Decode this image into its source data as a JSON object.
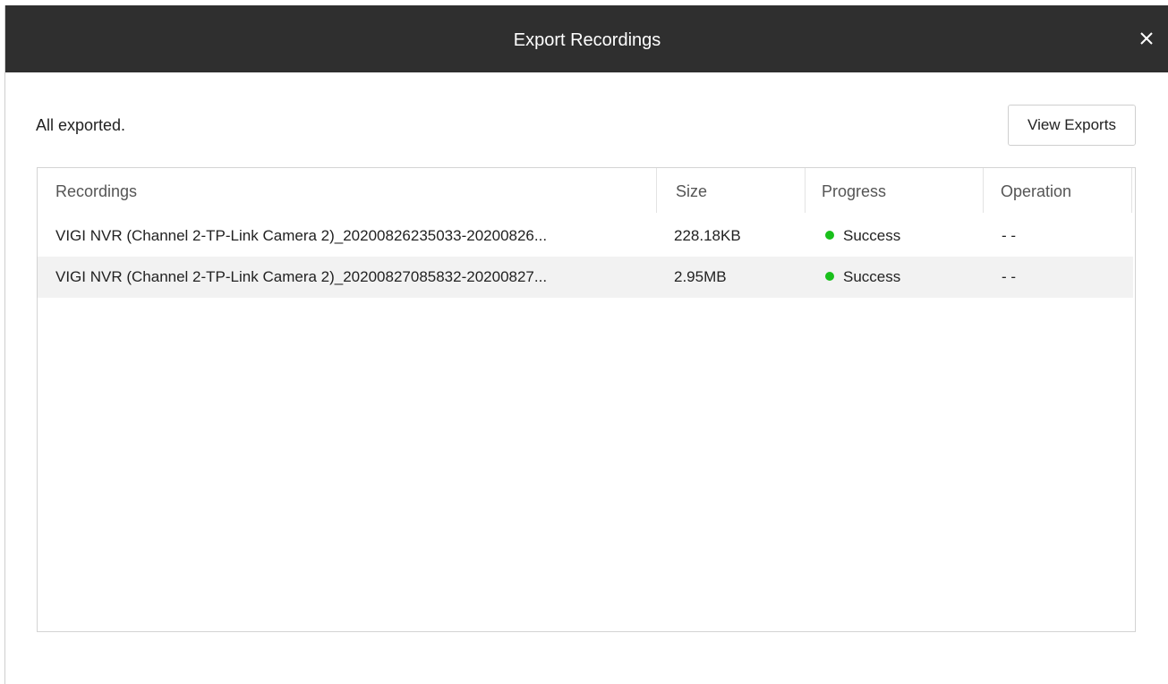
{
  "dialog": {
    "title": "Export Recordings",
    "close_icon": "close-icon"
  },
  "status_message": "All exported.",
  "view_exports_label": "View Exports",
  "table": {
    "headers": [
      "Recordings",
      "Size",
      "Progress",
      "Operation"
    ],
    "rows": [
      {
        "recording": "VIGI NVR (Channel  2-TP-Link Camera 2)_20200826235033-20200826...",
        "size": "228.18KB",
        "progress": "Success",
        "operation": "- -"
      },
      {
        "recording": "VIGI NVR (Channel  2-TP-Link Camera 2)_20200827085832-20200827...",
        "size": "2.95MB",
        "progress": "Success",
        "operation": "- -"
      }
    ]
  },
  "colors": {
    "titlebar": "#2f2f2f",
    "success": "#19c01b",
    "alt_row": "#f2f2f2"
  }
}
